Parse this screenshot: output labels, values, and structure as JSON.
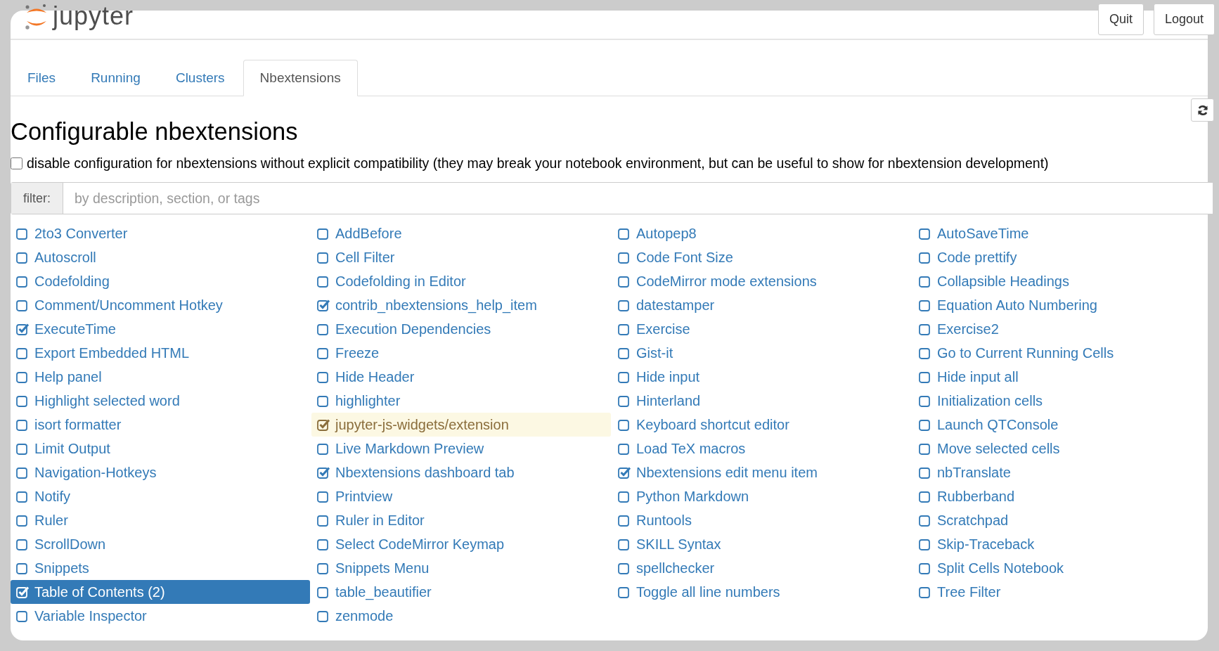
{
  "header": {
    "logo_text": "jupyter",
    "buttons": [
      "Quit",
      "Logout"
    ]
  },
  "tabs": [
    {
      "label": "Files",
      "selected": false
    },
    {
      "label": "Running",
      "selected": false
    },
    {
      "label": "Clusters",
      "selected": false
    },
    {
      "label": "Nbextensions",
      "selected": true
    }
  ],
  "heading": "Configurable nbextensions",
  "compat_option": {
    "label": "disable configuration for nbextensions without explicit compatibility (they may break your notebook environment, but can be useful to show for nbextension development)",
    "checked": false
  },
  "filter": {
    "label": "filter:",
    "placeholder": "by description, section, or tags"
  },
  "extensions": [
    {
      "name": "2to3 Converter",
      "checked": false,
      "selected": false,
      "incompatible": false
    },
    {
      "name": "AddBefore",
      "checked": false,
      "selected": false,
      "incompatible": false
    },
    {
      "name": "Autopep8",
      "checked": false,
      "selected": false,
      "incompatible": false
    },
    {
      "name": "AutoSaveTime",
      "checked": false,
      "selected": false,
      "incompatible": false
    },
    {
      "name": "Autoscroll",
      "checked": false,
      "selected": false,
      "incompatible": false
    },
    {
      "name": "Cell Filter",
      "checked": false,
      "selected": false,
      "incompatible": false
    },
    {
      "name": "Code Font Size",
      "checked": false,
      "selected": false,
      "incompatible": false
    },
    {
      "name": "Code prettify",
      "checked": false,
      "selected": false,
      "incompatible": false
    },
    {
      "name": "Codefolding",
      "checked": false,
      "selected": false,
      "incompatible": false
    },
    {
      "name": "Codefolding in Editor",
      "checked": false,
      "selected": false,
      "incompatible": false
    },
    {
      "name": "CodeMirror mode extensions",
      "checked": false,
      "selected": false,
      "incompatible": false
    },
    {
      "name": "Collapsible Headings",
      "checked": false,
      "selected": false,
      "incompatible": false
    },
    {
      "name": "Comment/Uncomment Hotkey",
      "checked": false,
      "selected": false,
      "incompatible": false
    },
    {
      "name": "contrib_nbextensions_help_item",
      "checked": true,
      "selected": false,
      "incompatible": false
    },
    {
      "name": "datestamper",
      "checked": false,
      "selected": false,
      "incompatible": false
    },
    {
      "name": "Equation Auto Numbering",
      "checked": false,
      "selected": false,
      "incompatible": false
    },
    {
      "name": "ExecuteTime",
      "checked": true,
      "selected": false,
      "incompatible": false
    },
    {
      "name": "Execution Dependencies",
      "checked": false,
      "selected": false,
      "incompatible": false
    },
    {
      "name": "Exercise",
      "checked": false,
      "selected": false,
      "incompatible": false
    },
    {
      "name": "Exercise2",
      "checked": false,
      "selected": false,
      "incompatible": false
    },
    {
      "name": "Export Embedded HTML",
      "checked": false,
      "selected": false,
      "incompatible": false
    },
    {
      "name": "Freeze",
      "checked": false,
      "selected": false,
      "incompatible": false
    },
    {
      "name": "Gist-it",
      "checked": false,
      "selected": false,
      "incompatible": false
    },
    {
      "name": "Go to Current Running Cells",
      "checked": false,
      "selected": false,
      "incompatible": false
    },
    {
      "name": "Help panel",
      "checked": false,
      "selected": false,
      "incompatible": false
    },
    {
      "name": "Hide Header",
      "checked": false,
      "selected": false,
      "incompatible": false
    },
    {
      "name": "Hide input",
      "checked": false,
      "selected": false,
      "incompatible": false
    },
    {
      "name": "Hide input all",
      "checked": false,
      "selected": false,
      "incompatible": false
    },
    {
      "name": "Highlight selected word",
      "checked": false,
      "selected": false,
      "incompatible": false
    },
    {
      "name": "highlighter",
      "checked": false,
      "selected": false,
      "incompatible": false
    },
    {
      "name": "Hinterland",
      "checked": false,
      "selected": false,
      "incompatible": false
    },
    {
      "name": "Initialization cells",
      "checked": false,
      "selected": false,
      "incompatible": false
    },
    {
      "name": "isort formatter",
      "checked": false,
      "selected": false,
      "incompatible": false
    },
    {
      "name": "jupyter-js-widgets/extension",
      "checked": true,
      "selected": false,
      "incompatible": true
    },
    {
      "name": "Keyboard shortcut editor",
      "checked": false,
      "selected": false,
      "incompatible": false
    },
    {
      "name": "Launch QTConsole",
      "checked": false,
      "selected": false,
      "incompatible": false
    },
    {
      "name": "Limit Output",
      "checked": false,
      "selected": false,
      "incompatible": false
    },
    {
      "name": "Live Markdown Preview",
      "checked": false,
      "selected": false,
      "incompatible": false
    },
    {
      "name": "Load TeX macros",
      "checked": false,
      "selected": false,
      "incompatible": false
    },
    {
      "name": "Move selected cells",
      "checked": false,
      "selected": false,
      "incompatible": false
    },
    {
      "name": "Navigation-Hotkeys",
      "checked": false,
      "selected": false,
      "incompatible": false
    },
    {
      "name": "Nbextensions dashboard tab",
      "checked": true,
      "selected": false,
      "incompatible": false
    },
    {
      "name": "Nbextensions edit menu item",
      "checked": true,
      "selected": false,
      "incompatible": false
    },
    {
      "name": "nbTranslate",
      "checked": false,
      "selected": false,
      "incompatible": false
    },
    {
      "name": "Notify",
      "checked": false,
      "selected": false,
      "incompatible": false
    },
    {
      "name": "Printview",
      "checked": false,
      "selected": false,
      "incompatible": false
    },
    {
      "name": "Python Markdown",
      "checked": false,
      "selected": false,
      "incompatible": false
    },
    {
      "name": "Rubberband",
      "checked": false,
      "selected": false,
      "incompatible": false
    },
    {
      "name": "Ruler",
      "checked": false,
      "selected": false,
      "incompatible": false
    },
    {
      "name": "Ruler in Editor",
      "checked": false,
      "selected": false,
      "incompatible": false
    },
    {
      "name": "Runtools",
      "checked": false,
      "selected": false,
      "incompatible": false
    },
    {
      "name": "Scratchpad",
      "checked": false,
      "selected": false,
      "incompatible": false
    },
    {
      "name": "ScrollDown",
      "checked": false,
      "selected": false,
      "incompatible": false
    },
    {
      "name": "Select CodeMirror Keymap",
      "checked": false,
      "selected": false,
      "incompatible": false
    },
    {
      "name": "SKILL Syntax",
      "checked": false,
      "selected": false,
      "incompatible": false
    },
    {
      "name": "Skip-Traceback",
      "checked": false,
      "selected": false,
      "incompatible": false
    },
    {
      "name": "Snippets",
      "checked": false,
      "selected": false,
      "incompatible": false
    },
    {
      "name": "Snippets Menu",
      "checked": false,
      "selected": false,
      "incompatible": false
    },
    {
      "name": "spellchecker",
      "checked": false,
      "selected": false,
      "incompatible": false
    },
    {
      "name": "Split Cells Notebook",
      "checked": false,
      "selected": false,
      "incompatible": false
    },
    {
      "name": "Table of Contents (2)",
      "checked": true,
      "selected": true,
      "incompatible": false
    },
    {
      "name": "table_beautifier",
      "checked": false,
      "selected": false,
      "incompatible": false
    },
    {
      "name": "Toggle all line numbers",
      "checked": false,
      "selected": false,
      "incompatible": false
    },
    {
      "name": "Tree Filter",
      "checked": false,
      "selected": false,
      "incompatible": false
    },
    {
      "name": "Variable Inspector",
      "checked": false,
      "selected": false,
      "incompatible": false
    },
    {
      "name": "zenmode",
      "checked": false,
      "selected": false,
      "incompatible": false
    }
  ]
}
